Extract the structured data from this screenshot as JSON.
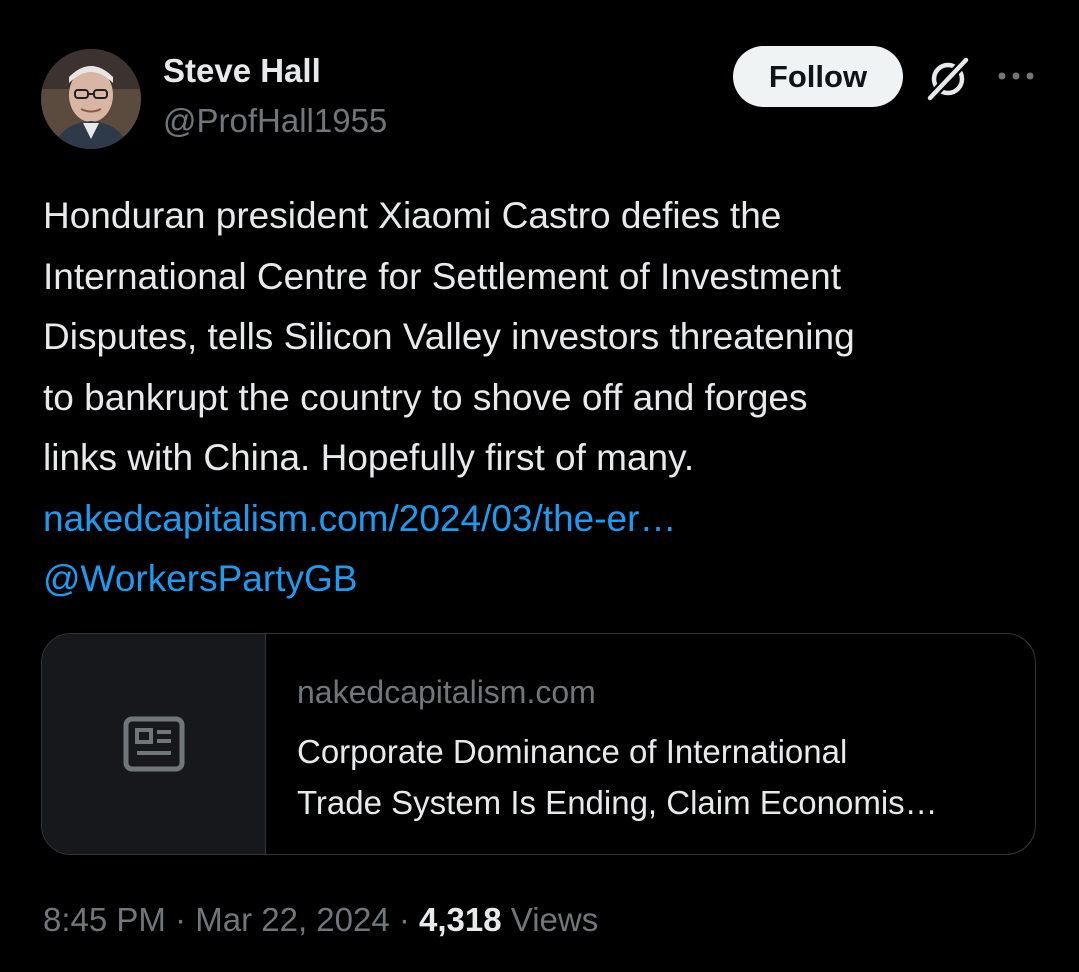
{
  "author": {
    "display_name": "Steve Hall",
    "handle": "@ProfHall1955"
  },
  "actions": {
    "follow_label": "Follow",
    "grok_icon": "grok-icon",
    "more_icon": "more-options-icon"
  },
  "tweet": {
    "lines": [
      "Honduran president Xiaomi Castro defies the",
      "International Centre for Settlement of Investment",
      "Disputes, tells Silicon Valley investors threatening",
      "to bankrupt the country to shove off and forges",
      "links with China. Hopefully first of many."
    ],
    "link_url_text": "nakedcapitalism.com/2024/03/the-er…",
    "mention": "@WorkersPartyGB"
  },
  "card": {
    "domain": "nakedcapitalism.com",
    "title_lines": [
      "Corporate Dominance of International",
      "Trade System Is Ending, Claim Economis…"
    ],
    "thumbnail_icon": "news-article-icon"
  },
  "meta": {
    "time": "8:45 PM",
    "separator": " · ",
    "date": "Mar 22, 2024",
    "views_count": "4,318",
    "views_label": "Views"
  },
  "colors": {
    "background": "#000000",
    "text_primary": "#e7e9ea",
    "text_secondary": "#71767b",
    "link": "#1d9bf0",
    "follow_button_bg": "#eff3f4",
    "card_border": "#333639"
  }
}
